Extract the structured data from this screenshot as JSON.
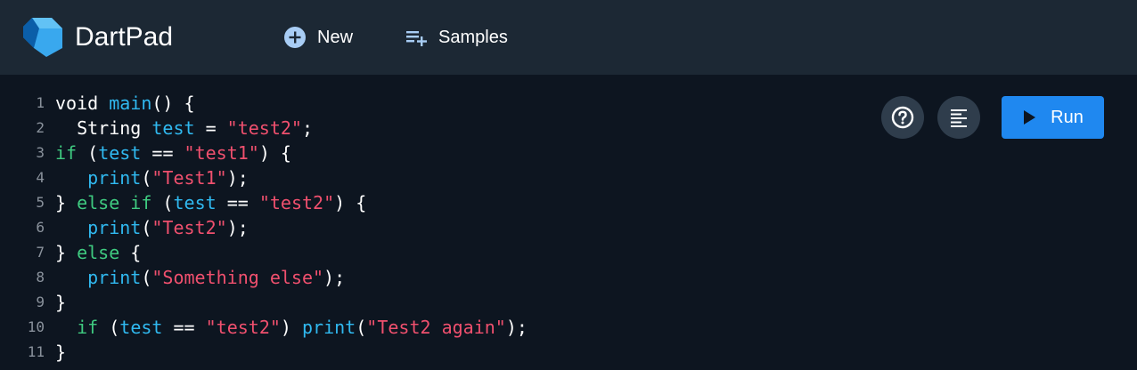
{
  "app": {
    "title": "DartPad"
  },
  "toolbar": {
    "new_label": "New",
    "samples_label": "Samples"
  },
  "editor": {
    "line_numbers": [
      "1",
      "2",
      "3",
      "4",
      "5",
      "6",
      "7",
      "8",
      "9",
      "10",
      "11"
    ],
    "lines": [
      [
        {
          "t": "void ",
          "c": "pl"
        },
        {
          "t": "main",
          "c": "fn"
        },
        {
          "t": "() {",
          "c": "pl"
        }
      ],
      [
        {
          "t": "  String ",
          "c": "pl"
        },
        {
          "t": "test",
          "c": "fn"
        },
        {
          "t": " = ",
          "c": "pl"
        },
        {
          "t": "\"test2\"",
          "c": "str"
        },
        {
          "t": ";",
          "c": "pl"
        }
      ],
      [
        {
          "t": "if",
          "c": "kw"
        },
        {
          "t": " (",
          "c": "pl"
        },
        {
          "t": "test",
          "c": "fn"
        },
        {
          "t": " == ",
          "c": "pl"
        },
        {
          "t": "\"test1\"",
          "c": "str"
        },
        {
          "t": ") {",
          "c": "pl"
        }
      ],
      [
        {
          "t": "   ",
          "c": "pl"
        },
        {
          "t": "print",
          "c": "fn"
        },
        {
          "t": "(",
          "c": "pl"
        },
        {
          "t": "\"Test1\"",
          "c": "str"
        },
        {
          "t": ");",
          "c": "pl"
        }
      ],
      [
        {
          "t": "} ",
          "c": "pl"
        },
        {
          "t": "else if",
          "c": "kw"
        },
        {
          "t": " (",
          "c": "pl"
        },
        {
          "t": "test",
          "c": "fn"
        },
        {
          "t": " == ",
          "c": "pl"
        },
        {
          "t": "\"test2\"",
          "c": "str"
        },
        {
          "t": ") {",
          "c": "pl"
        }
      ],
      [
        {
          "t": "   ",
          "c": "pl"
        },
        {
          "t": "print",
          "c": "fn"
        },
        {
          "t": "(",
          "c": "pl"
        },
        {
          "t": "\"Test2\"",
          "c": "str"
        },
        {
          "t": ");",
          "c": "pl"
        }
      ],
      [
        {
          "t": "} ",
          "c": "pl"
        },
        {
          "t": "else",
          "c": "kw"
        },
        {
          "t": " {",
          "c": "pl"
        }
      ],
      [
        {
          "t": "   ",
          "c": "pl"
        },
        {
          "t": "print",
          "c": "fn"
        },
        {
          "t": "(",
          "c": "pl"
        },
        {
          "t": "\"Something else\"",
          "c": "str"
        },
        {
          "t": ");",
          "c": "pl"
        }
      ],
      [
        {
          "t": "}",
          "c": "pl"
        }
      ],
      [
        {
          "t": "  ",
          "c": "pl"
        },
        {
          "t": "if",
          "c": "kw"
        },
        {
          "t": " (",
          "c": "pl"
        },
        {
          "t": "test",
          "c": "fn"
        },
        {
          "t": " == ",
          "c": "pl"
        },
        {
          "t": "\"test2\"",
          "c": "str"
        },
        {
          "t": ") ",
          "c": "pl"
        },
        {
          "t": "print",
          "c": "fn"
        },
        {
          "t": "(",
          "c": "pl"
        },
        {
          "t": "\"Test2 again\"",
          "c": "str"
        },
        {
          "t": ");",
          "c": "pl"
        }
      ],
      [
        {
          "t": "}",
          "c": "pl"
        }
      ]
    ]
  },
  "actions": {
    "run_label": "Run",
    "help_icon": "help-circle-icon",
    "format_icon": "format-align-icon"
  },
  "colors": {
    "header_bg": "#1c2834",
    "editor_bg": "#0d1520",
    "keyword": "#3fca80",
    "function": "#30b9f0",
    "string": "#f0506e",
    "run_button": "#1f88f0"
  }
}
